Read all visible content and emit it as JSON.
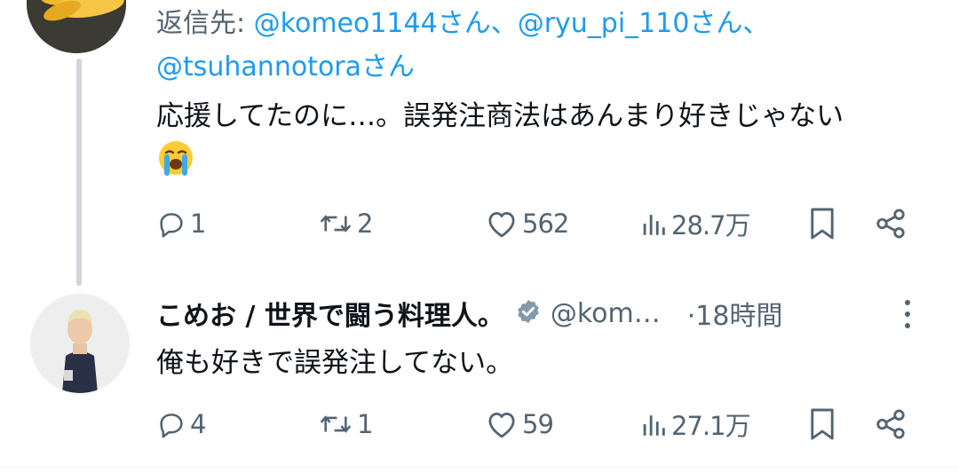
{
  "tweet1": {
    "reply_prefix": "返信先: ",
    "mentions_line1": "@komeo1144さん、@ryu_pi_110さん、",
    "mentions_line2": "@tsuhannotoraさん",
    "text": "応援してたのに…。誤発注商法はあんまり好きじゃない",
    "emoji": "loudly-crying-face",
    "actions": {
      "replies": "1",
      "reposts": "2",
      "likes": "562",
      "views": "28.7万"
    }
  },
  "tweet2": {
    "display_name": "こめお / 世界で闘う料理人。",
    "handle": "@kom…",
    "timestamp": "·18時間",
    "text": "俺も好きで誤発注してない。",
    "actions": {
      "replies": "4",
      "reposts": "1",
      "likes": "59",
      "views": "27.1万"
    }
  },
  "colors": {
    "mention": "#1d9bf0",
    "muted": "#536471",
    "verified": "#829aab",
    "thread_line": "#d0d6db"
  }
}
